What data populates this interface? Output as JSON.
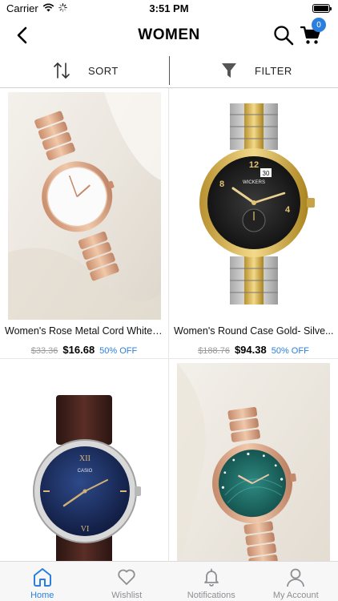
{
  "status_bar": {
    "carrier": "Carrier",
    "time": "3:51 PM",
    "icons": [
      "wifi-icon",
      "activity-spinner-icon",
      "battery-icon"
    ]
  },
  "header": {
    "title": "WOMEN",
    "cart_count": "0",
    "icons": [
      "chevron-left-icon",
      "search-icon",
      "cart-icon"
    ]
  },
  "toolbar": {
    "sort_label": "SORT",
    "filter_label": "FILTER"
  },
  "products": [
    {
      "name": "Women's Rose Metal Cord White I...",
      "old_price": "$33.36",
      "price": "$16.68",
      "discount": "50% OFF",
      "image": "rose-gold-watch-white-dial"
    },
    {
      "name": "Women's Round Case Gold- Silve...",
      "old_price": "$188.76",
      "price": "$94.38",
      "discount": "50% OFF",
      "image": "gold-silver-watch-black-dial",
      "dial_text": [
        "WICKERS",
        "30",
        "12",
        "4",
        "8"
      ]
    },
    {
      "name": "",
      "image": "brown-leather-watch-blue-dial",
      "dial_text": [
        "CASIO",
        "XII",
        "VI"
      ]
    },
    {
      "name": "",
      "image": "rose-gold-watch-green-dial"
    }
  ],
  "tabs": [
    {
      "label": "Home",
      "icon": "home-icon",
      "active": true
    },
    {
      "label": "Wishlist",
      "icon": "heart-icon",
      "active": false
    },
    {
      "label": "Notifications",
      "icon": "bell-icon",
      "active": false
    },
    {
      "label": "My Account",
      "icon": "user-icon",
      "active": false
    }
  ],
  "colors": {
    "accent": "#2a7fde",
    "inactive_tab": "#8e8e93",
    "strike_price": "#9a9a9a"
  }
}
